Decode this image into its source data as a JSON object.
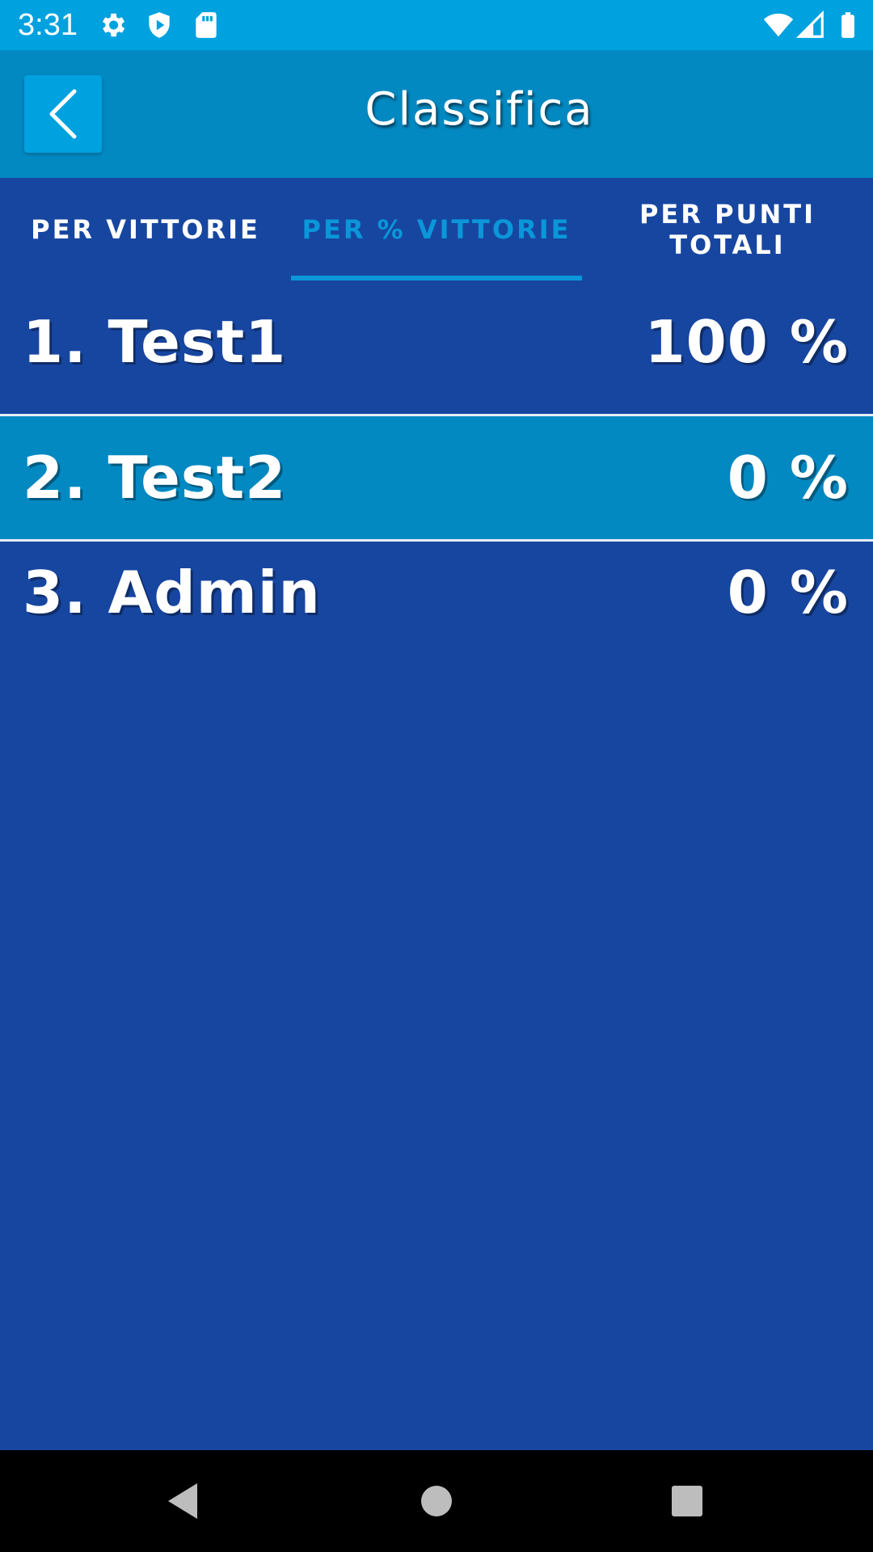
{
  "status_bar": {
    "time": "3:31",
    "icons_left": [
      "settings-icon",
      "shield-play-icon",
      "sd-card-icon"
    ],
    "icons_right": [
      "wifi-icon",
      "signal-icon",
      "battery-icon"
    ]
  },
  "app_bar": {
    "title": "Classifica",
    "back_icon": "chevron-left-icon"
  },
  "tabs": [
    {
      "label": "PER VITTORIE",
      "active": false
    },
    {
      "label": "PER % VITTORIE",
      "active": true
    },
    {
      "label": "PER PUNTI\nTOTALI",
      "active": false
    }
  ],
  "ranking": [
    {
      "name": "1. Test1",
      "value": "100 %",
      "highlighted": false
    },
    {
      "name": "2. Test2",
      "value": "0 %",
      "highlighted": true
    },
    {
      "name": "3. Admin",
      "value": "0 %",
      "highlighted": false
    }
  ],
  "colors": {
    "status_bar": "#00A1DF",
    "app_bar": "#0289C2",
    "background": "#1746A0",
    "highlight_row": "#0289C2",
    "active_tab": "#0A97D9"
  },
  "nav_bar": {
    "buttons": [
      "back-triangle-icon",
      "home-circle-icon",
      "recents-square-icon"
    ]
  }
}
